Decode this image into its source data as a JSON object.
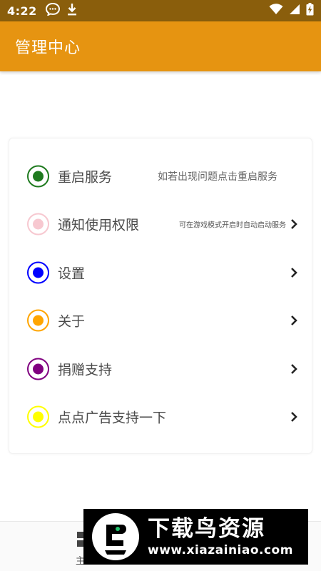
{
  "status_bar": {
    "time": "4:22",
    "left_icons": [
      "chat-bubble-icon",
      "download-icon"
    ],
    "right_icons": [
      "wifi-icon",
      "signal-icon",
      "battery-charging-icon"
    ]
  },
  "app_bar": {
    "title": "管理中心"
  },
  "menu": {
    "items": [
      {
        "label": "重启服务",
        "hint": "如若出现问题点击重启服务",
        "color": "#1f7a1f",
        "has_chevron": false
      },
      {
        "label": "通知使用权限",
        "hint": "可在游戏模式开启时自动启动服务",
        "color": "#f7c8d0",
        "has_chevron": true
      },
      {
        "label": "设置",
        "hint": "",
        "color": "#0000ff",
        "has_chevron": true
      },
      {
        "label": "关于",
        "hint": "",
        "color": "#ffa500",
        "has_chevron": true
      },
      {
        "label": "捐赠支持",
        "hint": "",
        "color": "#800080",
        "has_chevron": true
      },
      {
        "label": "点点广告支持一下",
        "hint": "",
        "color": "#ffff00",
        "has_chevron": true
      }
    ]
  },
  "bottom_nav": {
    "home_label": "主"
  },
  "watermark": {
    "title": "下载鸟资源",
    "url": "www.xiazainiao.com"
  }
}
